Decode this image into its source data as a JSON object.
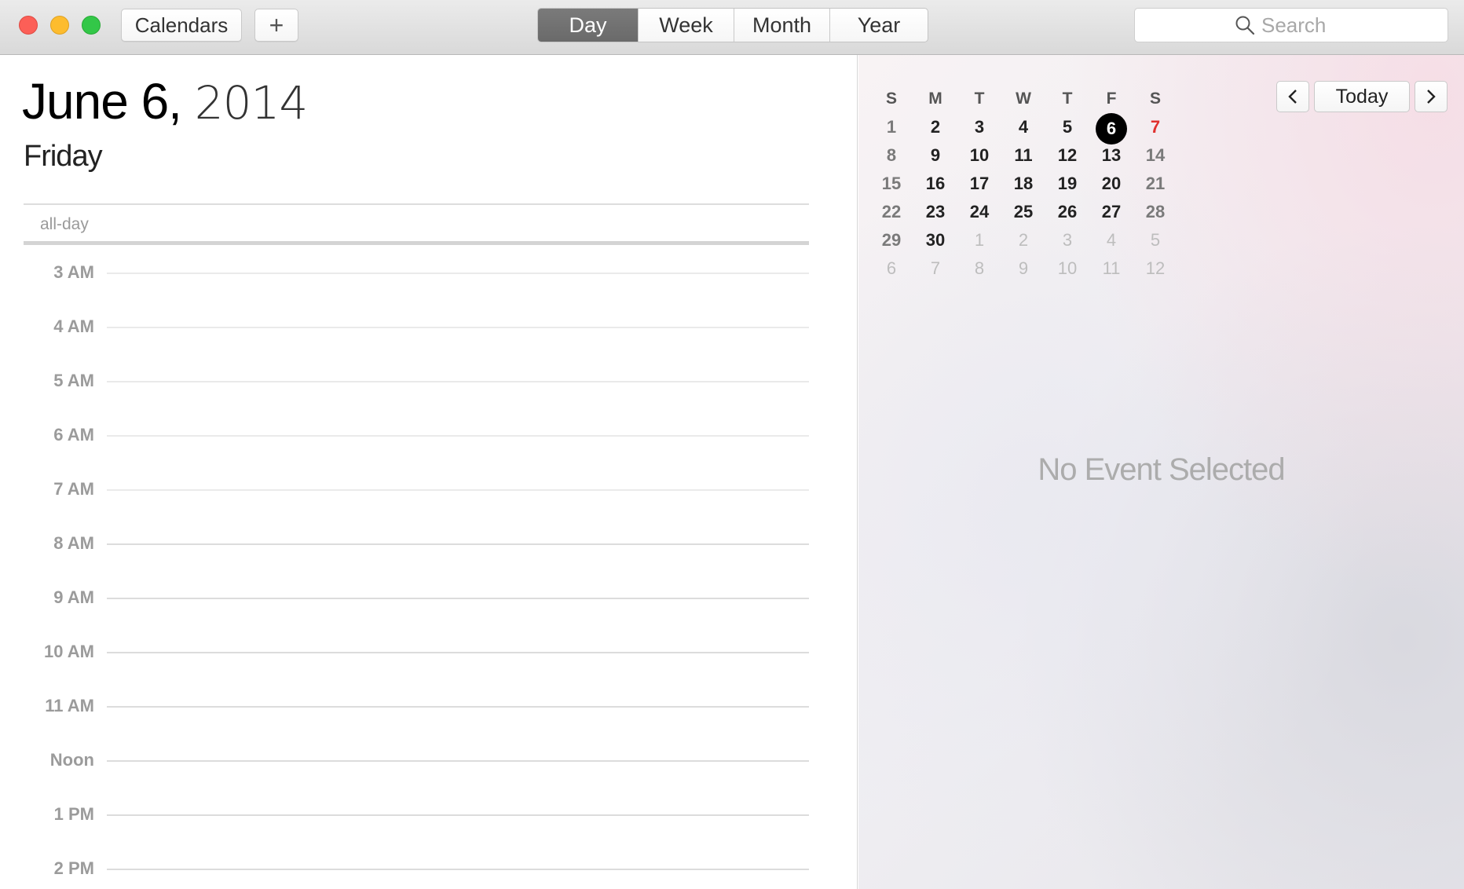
{
  "toolbar": {
    "calendars_label": "Calendars",
    "add_label": "+",
    "views": [
      "Day",
      "Week",
      "Month",
      "Year"
    ],
    "active_view": "Day",
    "search_placeholder": "Search",
    "search_value": ""
  },
  "day_view": {
    "month_day": "June 6,",
    "year": "2014",
    "weekday": "Friday",
    "allday_label": "all-day",
    "hours": [
      "3 AM",
      "4 AM",
      "5 AM",
      "6 AM",
      "7 AM",
      "8 AM",
      "9 AM",
      "10 AM",
      "11 AM",
      "Noon",
      "1 PM",
      "2 PM"
    ]
  },
  "mini_calendar": {
    "weekday_headers": [
      "S",
      "M",
      "T",
      "W",
      "T",
      "F",
      "S"
    ],
    "weeks": [
      [
        "1",
        "2",
        "3",
        "4",
        "5",
        "6",
        "7"
      ],
      [
        "8",
        "9",
        "10",
        "11",
        "12",
        "13",
        "14"
      ],
      [
        "15",
        "16",
        "17",
        "18",
        "19",
        "20",
        "21"
      ],
      [
        "22",
        "23",
        "24",
        "25",
        "26",
        "27",
        "28"
      ],
      [
        "29",
        "30",
        "1",
        "2",
        "3",
        "4",
        "5"
      ],
      [
        "6",
        "7",
        "8",
        "9",
        "10",
        "11",
        "12"
      ]
    ],
    "selected_day": "6",
    "prev_label": "‹",
    "today_label": "Today",
    "next_label": "›",
    "highlight_color": "#e0302e"
  },
  "detail": {
    "empty_text": "No Event Selected"
  },
  "colors": {
    "close": "#fc5f57",
    "minimize": "#fdbc2e",
    "maximize": "#33c748",
    "active_segment": "#6f6f6f"
  }
}
